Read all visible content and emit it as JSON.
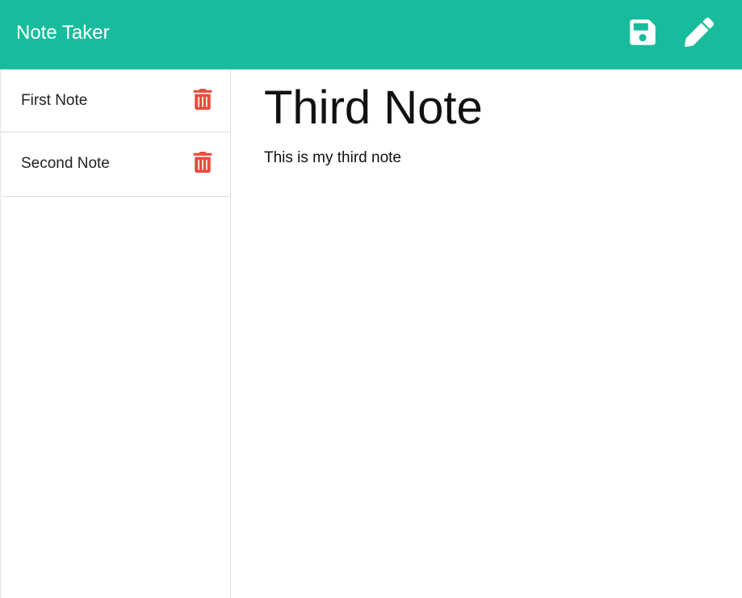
{
  "header": {
    "brand": "Note Taker",
    "save_icon": "floppy-disk-icon",
    "write_icon": "pencil-icon",
    "background_color": "#18bc9c"
  },
  "sidebar": {
    "notes": [
      {
        "title": "First Note",
        "delete_icon": "trash-icon"
      },
      {
        "title": "Second Note",
        "delete_icon": "trash-icon"
      }
    ],
    "delete_color": "#e74c3c"
  },
  "editor": {
    "title_value": "Third Note",
    "text_value": "This is my third note"
  }
}
